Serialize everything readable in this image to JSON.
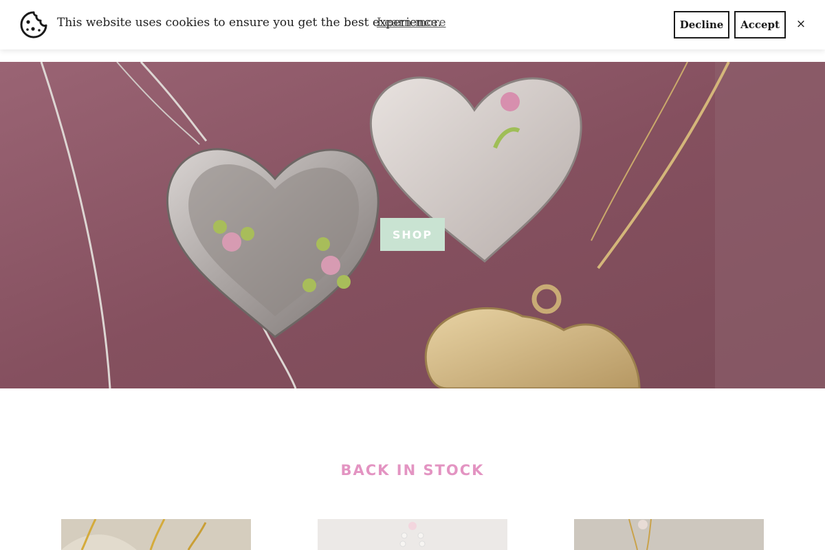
{
  "cookie_banner": {
    "message": "This website uses cookies to ensure you get the best experience.",
    "learn_more": "Learn more",
    "decline": "Decline",
    "accept": "Accept",
    "close": "×",
    "icon": "cookie-icon"
  },
  "hero": {
    "cta_label": "SHOP",
    "colors": {
      "background": "#8e5a69",
      "cta_bg": "#c9e3d2"
    }
  },
  "back_in_stock": {
    "title": "BACK IN STOCK",
    "title_color": "#e394c2",
    "products": [
      {
        "image": "gold-chain-necklace"
      },
      {
        "image": "pearl-necklace"
      },
      {
        "image": "gold-pendant-necklace"
      }
    ]
  }
}
